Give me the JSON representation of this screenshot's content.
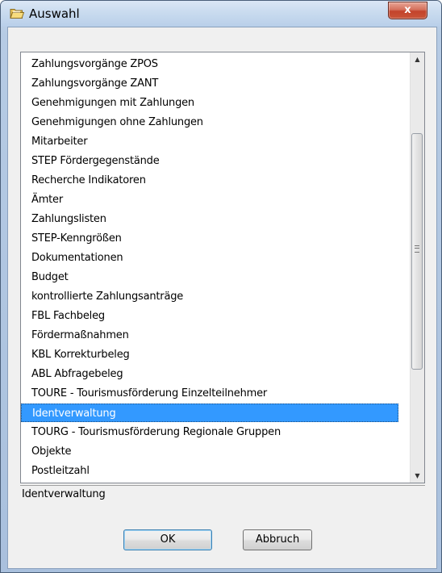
{
  "window": {
    "title": "Auswahl",
    "close_label": "x"
  },
  "list": {
    "items": [
      "Zahlungsvorgänge ZPOS",
      "Zahlungsvorgänge ZANT",
      "Genehmigungen mit Zahlungen",
      "Genehmigungen ohne Zahlungen",
      "Mitarbeiter",
      "STEP Fördergegenstände",
      "Recherche Indikatoren",
      "Ämter",
      "Zahlungslisten",
      "STEP-Kenngrößen",
      "Dokumentationen",
      "Budget",
      "kontrollierte Zahlungsanträge",
      "FBL Fachbeleg",
      "Fördermaßnahmen",
      "KBL Korrekturbeleg",
      "ABL Abfragebeleg",
      "TOURE - Tourismusförderung Einzelteilnehmer",
      "Identverwaltung",
      "TOURG - Tourismusförderung Regionale Gruppen",
      "Objekte",
      "Postleitzahl"
    ],
    "selected_index": 18
  },
  "status": {
    "text": "Identverwaltung"
  },
  "buttons": {
    "ok_label": "OK",
    "cancel_label": "Abbruch"
  },
  "icons": {
    "title": "folder-open-icon",
    "close": "close-icon",
    "scroll_up": "arrow-up-icon",
    "scroll_down": "arrow-down-icon"
  },
  "colors": {
    "selection": "#3399ff",
    "selection_text": "#ffffff",
    "close_button": "#c3432b"
  }
}
